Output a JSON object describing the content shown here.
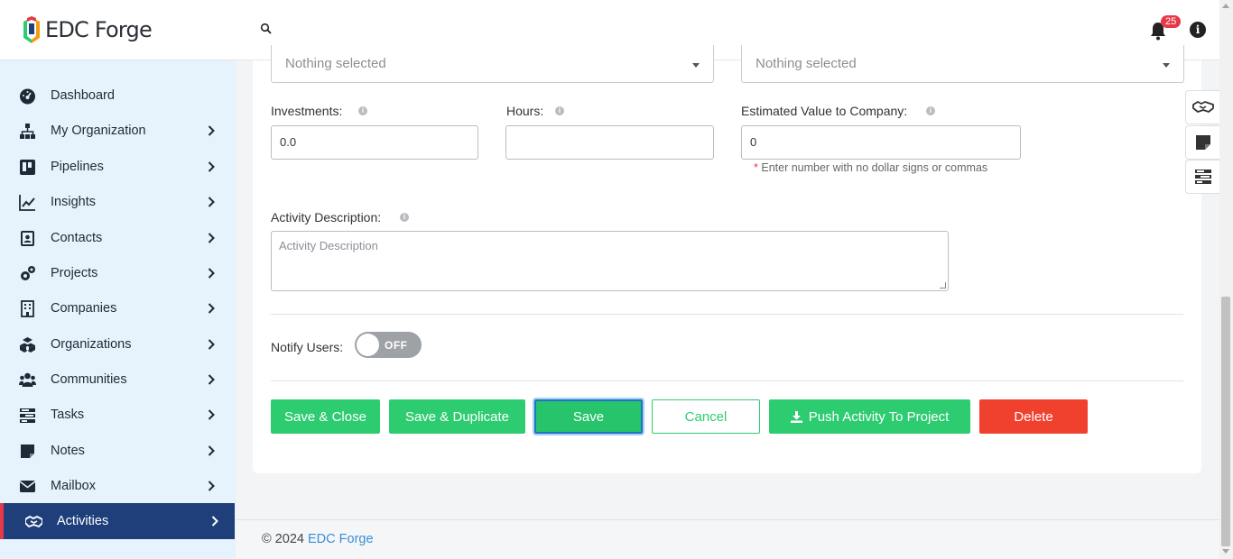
{
  "app": {
    "name": "EDC Forge"
  },
  "header": {
    "notifications_count": "25"
  },
  "sidebar": {
    "items": [
      {
        "label": "Dashboard",
        "icon": "dashboard-icon",
        "has_chevron": false
      },
      {
        "label": "My Organization",
        "icon": "org-chart-icon",
        "has_chevron": true
      },
      {
        "label": "Pipelines",
        "icon": "pipelines-icon",
        "has_chevron": true
      },
      {
        "label": "Insights",
        "icon": "chart-line-icon",
        "has_chevron": true
      },
      {
        "label": "Contacts",
        "icon": "contact-card-icon",
        "has_chevron": true
      },
      {
        "label": "Projects",
        "icon": "gears-icon",
        "has_chevron": true
      },
      {
        "label": "Companies",
        "icon": "building-icon",
        "has_chevron": true
      },
      {
        "label": "Organizations",
        "icon": "cubes-icon",
        "has_chevron": true
      },
      {
        "label": "Communities",
        "icon": "users-icon",
        "has_chevron": true
      },
      {
        "label": "Tasks",
        "icon": "tasks-icon",
        "has_chevron": true
      },
      {
        "label": "Notes",
        "icon": "sticky-note-icon",
        "has_chevron": true
      },
      {
        "label": "Mailbox",
        "icon": "envelope-icon",
        "has_chevron": true
      },
      {
        "label": "Activities",
        "icon": "handshake-icon",
        "has_chevron": true,
        "active": true
      }
    ]
  },
  "form": {
    "select_left": {
      "value": "Nothing selected"
    },
    "select_right": {
      "value": "Nothing selected"
    },
    "investments": {
      "label": "Investments:",
      "value": "0.0"
    },
    "hours": {
      "label": "Hours:",
      "value": ""
    },
    "estimated_value": {
      "label": "Estimated Value to Company:",
      "value": "0",
      "hint_star": "*",
      "hint": "Enter number with no dollar signs or commas"
    },
    "activity_description": {
      "label": "Activity Description:",
      "placeholder": "Activity Description"
    },
    "notify_users": {
      "label": "Notify Users:",
      "state": "OFF"
    }
  },
  "buttons": {
    "save_close": "Save & Close",
    "save_duplicate": "Save & Duplicate",
    "save": "Save",
    "cancel": "Cancel",
    "push_activity": "Push Activity To Project",
    "delete": "Delete"
  },
  "footer": {
    "copyright": "© 2024",
    "link": "EDC Forge"
  },
  "colors": {
    "primary_green": "#2ecc71",
    "danger_red": "#f0412f",
    "sidebar_active": "#1e3f7a",
    "sidebar_bg": "#e6f3fc",
    "link_blue": "#3a8fd6"
  }
}
